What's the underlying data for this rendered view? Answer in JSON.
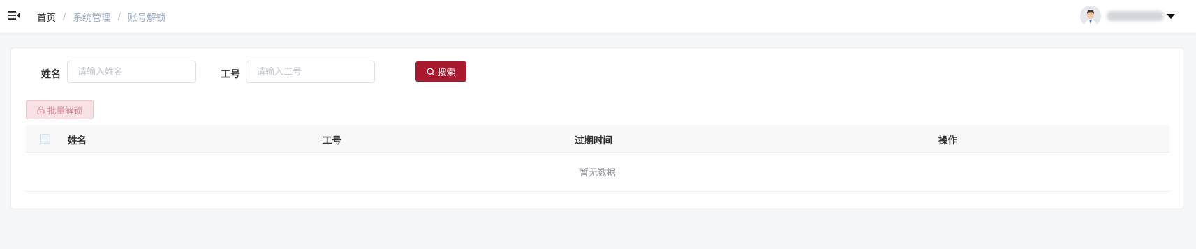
{
  "header": {
    "breadcrumb": {
      "home": "首页",
      "separator": "/",
      "items": [
        "系统管理",
        "账号解锁"
      ]
    }
  },
  "user": {
    "avatar_icon": "user-avatar-icon",
    "dropdown_icon": "caret-down-icon"
  },
  "search_form": {
    "name_label": "姓名",
    "name_placeholder": "请输入姓名",
    "name_value": "",
    "employee_id_label": "工号",
    "employee_id_placeholder": "请输入工号",
    "employee_id_value": "",
    "search_button": "搜索",
    "search_icon": "search-icon"
  },
  "toolbar": {
    "batch_unlock_button": "批量解锁",
    "batch_unlock_icon": "unlock-icon",
    "batch_unlock_disabled": true
  },
  "table": {
    "columns": [
      "姓名",
      "工号",
      "过期时间",
      "操作"
    ],
    "rows": [],
    "empty_text": "暂无数据"
  },
  "colors": {
    "primary": "#a8192e",
    "primary_disabled_bg": "#f6e1e4",
    "page_bg": "#f5f6f8",
    "breadcrumb_muted": "#97a8be"
  }
}
